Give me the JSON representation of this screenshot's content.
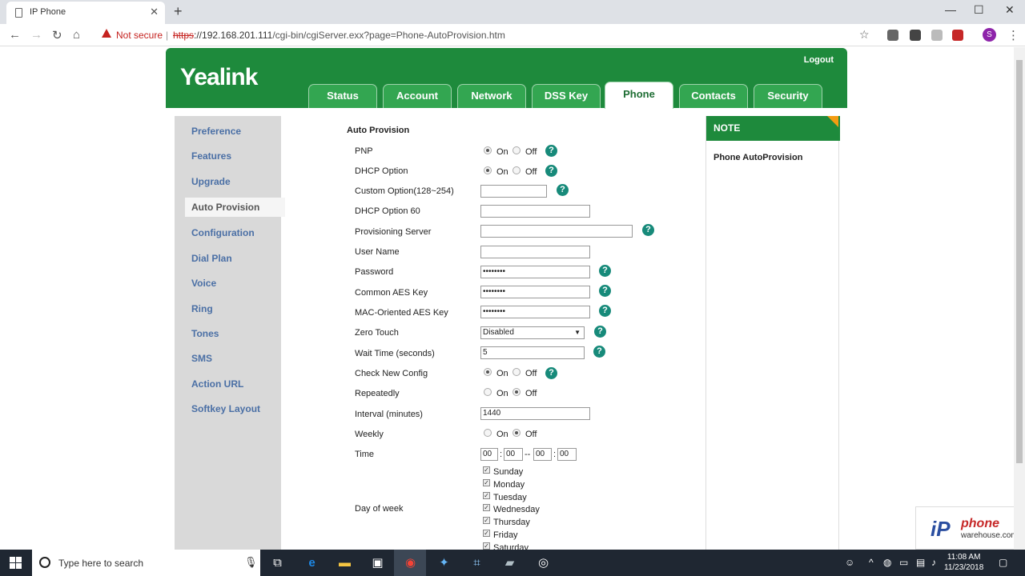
{
  "browser": {
    "tab_title": "IP Phone",
    "not_secure": "Not secure",
    "url_scheme": "https",
    "url_rest": "://192.168.201.111",
    "url_path": "/cgi-bin/cgiServer.exx?page=Phone-AutoProvision.htm",
    "profile_initial": "S"
  },
  "header": {
    "logo": "Yealink",
    "logout": "Logout",
    "tabs": [
      "Status",
      "Account",
      "Network",
      "DSS Key",
      "Phone",
      "Contacts",
      "Security"
    ],
    "active_tab": "Phone"
  },
  "sidebar": {
    "items": [
      "Preference",
      "Features",
      "Upgrade",
      "Auto Provision",
      "Configuration",
      "Dial Plan",
      "Voice",
      "Ring",
      "Tones",
      "SMS",
      "Action URL",
      "Softkey Layout"
    ],
    "active": "Auto Provision"
  },
  "form": {
    "section_title": "Auto Provision",
    "on_label": "On",
    "off_label": "Off",
    "pnp": {
      "label": "PNP",
      "value": "On"
    },
    "dhcp_option": {
      "label": "DHCP Option",
      "value": "On"
    },
    "custom_option": {
      "label": "Custom Option(128~254)",
      "value": ""
    },
    "dhcp_option_60": {
      "label": "DHCP Option 60",
      "value": ""
    },
    "provisioning_server": {
      "label": "Provisioning Server",
      "value": ""
    },
    "user_name": {
      "label": "User Name",
      "value": ""
    },
    "password": {
      "label": "Password",
      "value": "••••••••"
    },
    "common_aes_key": {
      "label": "Common AES Key",
      "value": "••••••••"
    },
    "mac_aes_key": {
      "label": "MAC-Oriented AES Key",
      "value": "••••••••"
    },
    "zero_touch": {
      "label": "Zero Touch",
      "value": "Disabled"
    },
    "wait_time": {
      "label": "Wait Time (seconds)",
      "value": "5"
    },
    "check_new_config": {
      "label": "Check New Config",
      "value": "On"
    },
    "repeatedly": {
      "label": "Repeatedly",
      "value": "Off"
    },
    "interval": {
      "label": "Interval (minutes)",
      "value": "1440"
    },
    "weekly": {
      "label": "Weekly",
      "value": "Off"
    },
    "time": {
      "label": "Time",
      "start_hour": "00",
      "start_min": "00",
      "end_hour": "00",
      "end_min": "00",
      "colon": ":",
      "dash": "--"
    },
    "day_of_week": {
      "label": "Day of week",
      "days": [
        "Sunday",
        "Monday",
        "Tuesday",
        "Wednesday",
        "Thursday",
        "Friday",
        "Saturday"
      ]
    }
  },
  "note": {
    "title": "NOTE",
    "body": "Phone AutoProvision"
  },
  "watermark": {
    "ip": "iP",
    "phone": "phone",
    "site": "warehouse.com"
  },
  "taskbar": {
    "search_placeholder": "Type here to search",
    "time": "11:08 AM",
    "date": "11/23/2018"
  },
  "colors": {
    "header_green": "#1e8a3c",
    "tab_green": "#33a651",
    "help_teal": "#178a7a",
    "note_corner": "#f39c12",
    "link_blue": "#4a6fa5"
  }
}
